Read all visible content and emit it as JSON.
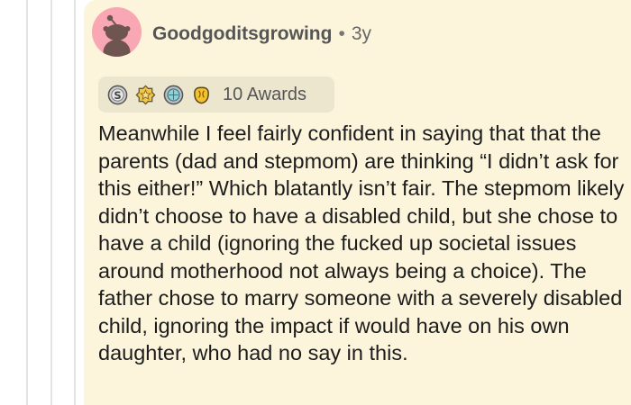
{
  "comment": {
    "author": "Goodgoditsgrowing",
    "separator": "•",
    "age": "3y",
    "awards": {
      "count_label": "10 Awards",
      "icons": [
        "silver-award-icon",
        "gold-award-icon",
        "platinum-award-icon",
        "wholesome-award-icon"
      ]
    },
    "body": "Meanwhile I feel fairly confident in saying that that the parents (dad and stepmom) are thinking “I didn’t ask for this either!” Which blatantly isn’t fair. The stepmom likely didn’t choose to have a disabled child, but she chose to have a child (ignoring the fucked up societal issues around motherhood not always being a choice). The father chose to marry someone with a severely disabled child, ignoring the impact if would have on his own daughter, who had no say in this."
  },
  "colors": {
    "comment_background": "#fcf5dc",
    "avatar_background": "#f8a7b3",
    "awards_background": "#ece6cf",
    "thread_line": "#e4e4e4",
    "text": "#1c1c1c",
    "meta_text": "#555555"
  }
}
